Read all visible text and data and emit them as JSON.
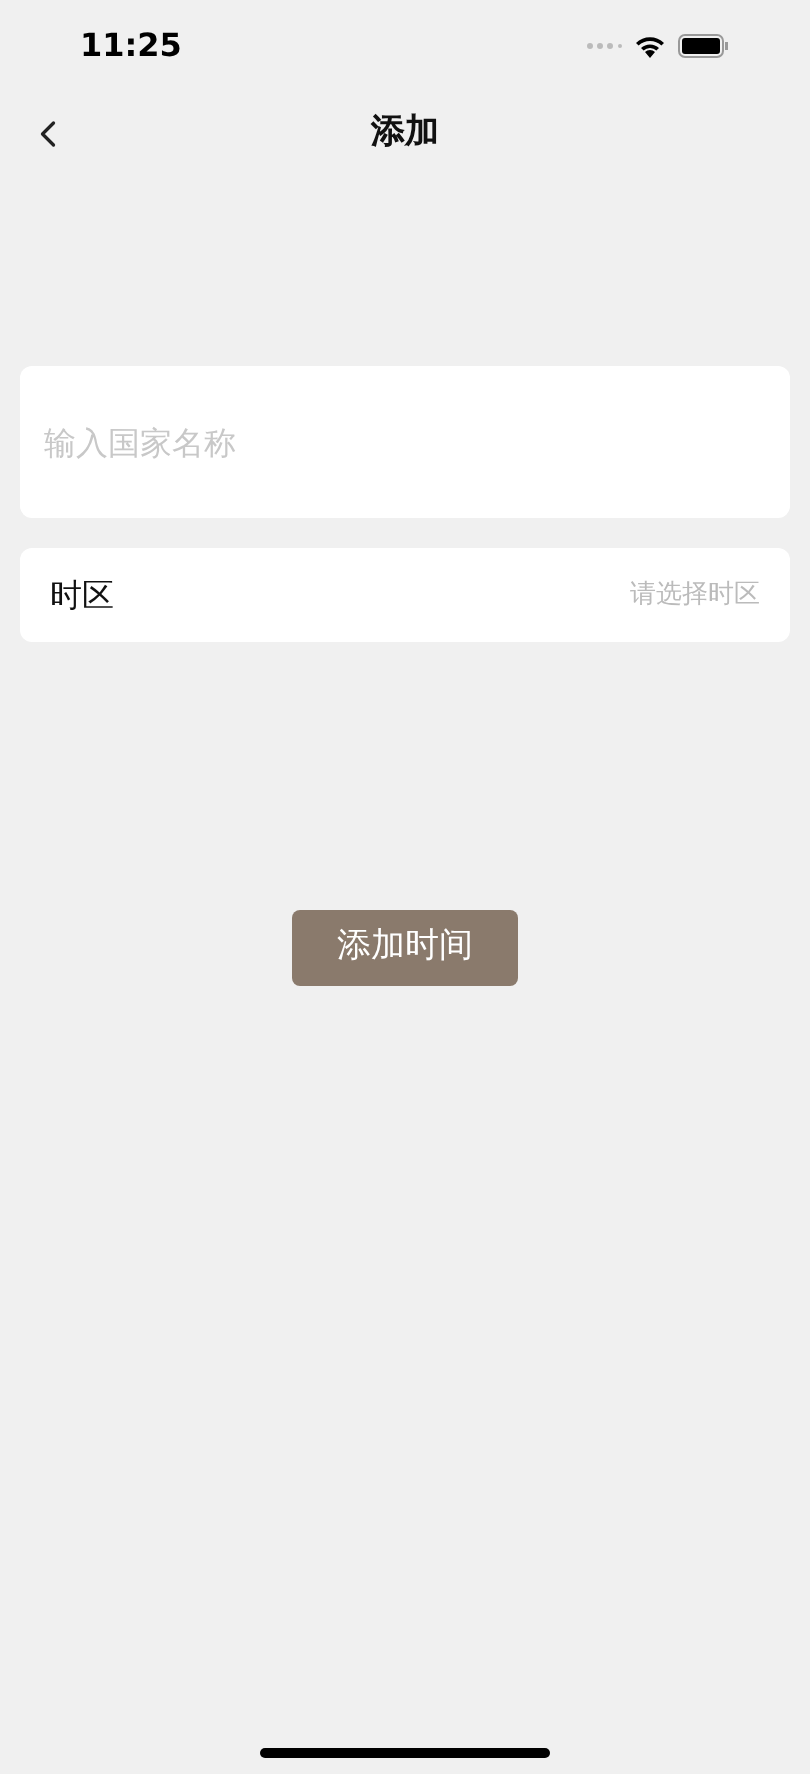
{
  "status_bar": {
    "time": "11:25"
  },
  "nav": {
    "title": "添加"
  },
  "country_field": {
    "placeholder": "输入国家名称"
  },
  "timezone_row": {
    "label": "时区",
    "placeholder": "请选择时区"
  },
  "add_button": {
    "label": "添加时间"
  }
}
